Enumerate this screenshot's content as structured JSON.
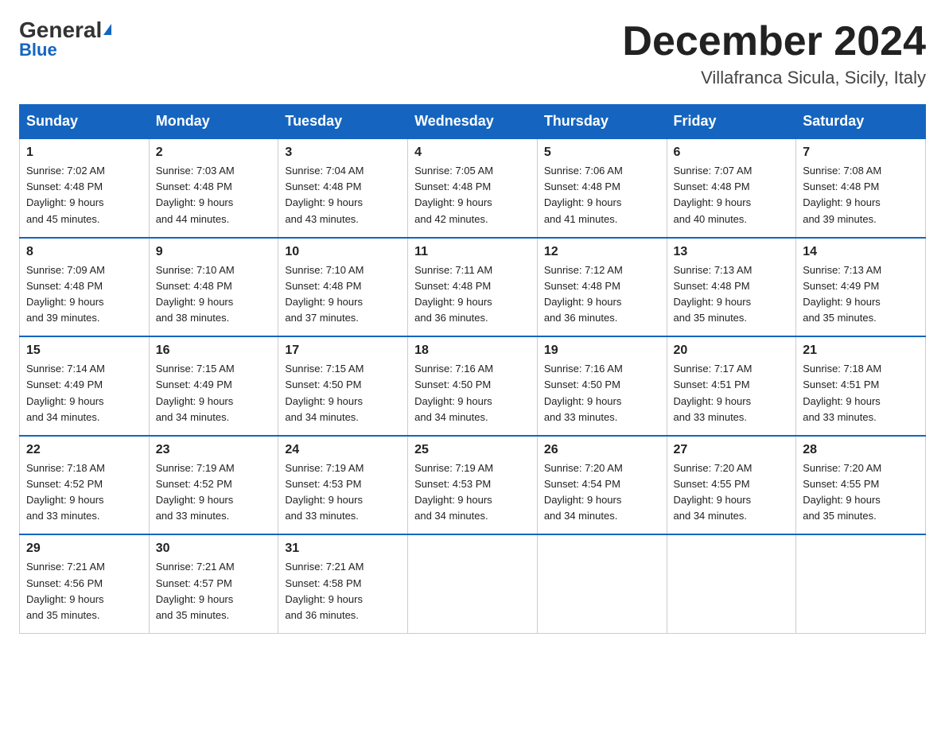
{
  "header": {
    "logo_general": "General",
    "logo_blue": "Blue",
    "month_title": "December 2024",
    "location": "Villafranca Sicula, Sicily, Italy"
  },
  "days_of_week": [
    "Sunday",
    "Monday",
    "Tuesday",
    "Wednesday",
    "Thursday",
    "Friday",
    "Saturday"
  ],
  "weeks": [
    [
      {
        "day": "1",
        "sunrise": "7:02 AM",
        "sunset": "4:48 PM",
        "daylight": "9 hours and 45 minutes."
      },
      {
        "day": "2",
        "sunrise": "7:03 AM",
        "sunset": "4:48 PM",
        "daylight": "9 hours and 44 minutes."
      },
      {
        "day": "3",
        "sunrise": "7:04 AM",
        "sunset": "4:48 PM",
        "daylight": "9 hours and 43 minutes."
      },
      {
        "day": "4",
        "sunrise": "7:05 AM",
        "sunset": "4:48 PM",
        "daylight": "9 hours and 42 minutes."
      },
      {
        "day": "5",
        "sunrise": "7:06 AM",
        "sunset": "4:48 PM",
        "daylight": "9 hours and 41 minutes."
      },
      {
        "day": "6",
        "sunrise": "7:07 AM",
        "sunset": "4:48 PM",
        "daylight": "9 hours and 40 minutes."
      },
      {
        "day": "7",
        "sunrise": "7:08 AM",
        "sunset": "4:48 PM",
        "daylight": "9 hours and 39 minutes."
      }
    ],
    [
      {
        "day": "8",
        "sunrise": "7:09 AM",
        "sunset": "4:48 PM",
        "daylight": "9 hours and 39 minutes."
      },
      {
        "day": "9",
        "sunrise": "7:10 AM",
        "sunset": "4:48 PM",
        "daylight": "9 hours and 38 minutes."
      },
      {
        "day": "10",
        "sunrise": "7:10 AM",
        "sunset": "4:48 PM",
        "daylight": "9 hours and 37 minutes."
      },
      {
        "day": "11",
        "sunrise": "7:11 AM",
        "sunset": "4:48 PM",
        "daylight": "9 hours and 36 minutes."
      },
      {
        "day": "12",
        "sunrise": "7:12 AM",
        "sunset": "4:48 PM",
        "daylight": "9 hours and 36 minutes."
      },
      {
        "day": "13",
        "sunrise": "7:13 AM",
        "sunset": "4:48 PM",
        "daylight": "9 hours and 35 minutes."
      },
      {
        "day": "14",
        "sunrise": "7:13 AM",
        "sunset": "4:49 PM",
        "daylight": "9 hours and 35 minutes."
      }
    ],
    [
      {
        "day": "15",
        "sunrise": "7:14 AM",
        "sunset": "4:49 PM",
        "daylight": "9 hours and 34 minutes."
      },
      {
        "day": "16",
        "sunrise": "7:15 AM",
        "sunset": "4:49 PM",
        "daylight": "9 hours and 34 minutes."
      },
      {
        "day": "17",
        "sunrise": "7:15 AM",
        "sunset": "4:50 PM",
        "daylight": "9 hours and 34 minutes."
      },
      {
        "day": "18",
        "sunrise": "7:16 AM",
        "sunset": "4:50 PM",
        "daylight": "9 hours and 34 minutes."
      },
      {
        "day": "19",
        "sunrise": "7:16 AM",
        "sunset": "4:50 PM",
        "daylight": "9 hours and 33 minutes."
      },
      {
        "day": "20",
        "sunrise": "7:17 AM",
        "sunset": "4:51 PM",
        "daylight": "9 hours and 33 minutes."
      },
      {
        "day": "21",
        "sunrise": "7:18 AM",
        "sunset": "4:51 PM",
        "daylight": "9 hours and 33 minutes."
      }
    ],
    [
      {
        "day": "22",
        "sunrise": "7:18 AM",
        "sunset": "4:52 PM",
        "daylight": "9 hours and 33 minutes."
      },
      {
        "day": "23",
        "sunrise": "7:19 AM",
        "sunset": "4:52 PM",
        "daylight": "9 hours and 33 minutes."
      },
      {
        "day": "24",
        "sunrise": "7:19 AM",
        "sunset": "4:53 PM",
        "daylight": "9 hours and 33 minutes."
      },
      {
        "day": "25",
        "sunrise": "7:19 AM",
        "sunset": "4:53 PM",
        "daylight": "9 hours and 34 minutes."
      },
      {
        "day": "26",
        "sunrise": "7:20 AM",
        "sunset": "4:54 PM",
        "daylight": "9 hours and 34 minutes."
      },
      {
        "day": "27",
        "sunrise": "7:20 AM",
        "sunset": "4:55 PM",
        "daylight": "9 hours and 34 minutes."
      },
      {
        "day": "28",
        "sunrise": "7:20 AM",
        "sunset": "4:55 PM",
        "daylight": "9 hours and 35 minutes."
      }
    ],
    [
      {
        "day": "29",
        "sunrise": "7:21 AM",
        "sunset": "4:56 PM",
        "daylight": "9 hours and 35 minutes."
      },
      {
        "day": "30",
        "sunrise": "7:21 AM",
        "sunset": "4:57 PM",
        "daylight": "9 hours and 35 minutes."
      },
      {
        "day": "31",
        "sunrise": "7:21 AM",
        "sunset": "4:58 PM",
        "daylight": "9 hours and 36 minutes."
      },
      null,
      null,
      null,
      null
    ]
  ],
  "labels": {
    "sunrise": "Sunrise:",
    "sunset": "Sunset:",
    "daylight": "Daylight:"
  }
}
